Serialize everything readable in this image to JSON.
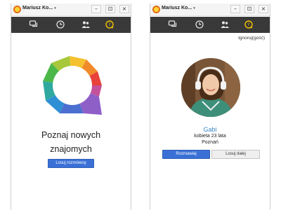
{
  "colors": {
    "toolbar_bg": "#393939",
    "primary_button": "#3a70d6",
    "name_link": "#3a88c8",
    "active_icon": "#f2c200"
  },
  "left_window": {
    "titlebar": {
      "user_name": "Mariusz Ko...",
      "dropdown_glyph": "▾",
      "min_glyph": "–",
      "cam_glyph": "⊡",
      "close_glyph": "×"
    },
    "toolbar": {
      "icons": [
        "chat-icon",
        "clock-icon",
        "contacts-icon",
        "random-chat-icon"
      ],
      "active": "random-chat-icon"
    },
    "intro": {
      "title_line1": "Poznaj nowych",
      "title_line2": "znajomych",
      "button_label": "Losuj rozmówcę"
    }
  },
  "right_window": {
    "titlebar": {
      "user_name": "Mariusz Ko...",
      "dropdown_glyph": "▾",
      "min_glyph": "–",
      "cam_glyph": "⊡",
      "close_glyph": "×"
    },
    "toolbar": {
      "icons": [
        "chat-icon",
        "clock-icon",
        "contacts-icon",
        "random-chat-icon"
      ],
      "active": "random-chat-icon"
    },
    "ignore_link": "Ignoruj(gość)",
    "profile": {
      "name": "Gabi",
      "age_line": "kobieta 23 lata",
      "city": "Poznań"
    },
    "buttons": {
      "talk": "Rozmawiaj",
      "draw_again": "Losuj dalej"
    }
  }
}
